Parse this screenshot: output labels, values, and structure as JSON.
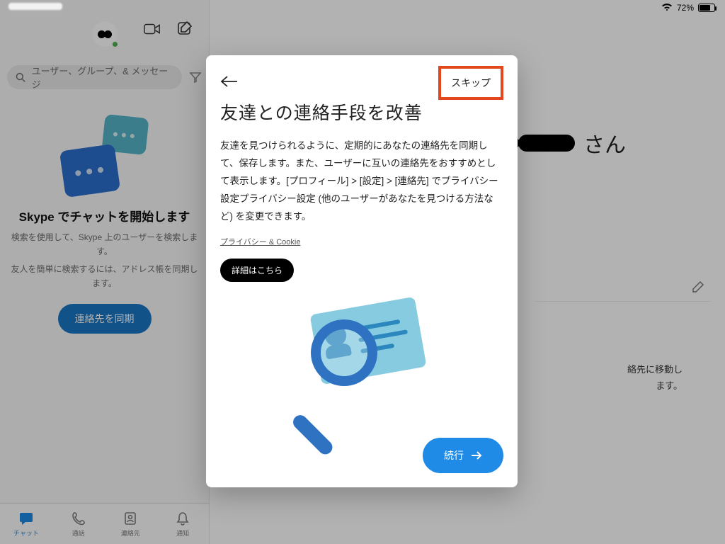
{
  "status": {
    "battery_pct": "72%"
  },
  "left": {
    "search_placeholder": "ユーザー、グループ、& メッセージ",
    "empty_title": "Skype でチャットを開始します",
    "empty_line1": "検索を使用して、Skype 上のユーザーを検索します。",
    "empty_line2": "友人を簡単に検索するには、アドレス帳を同期します。",
    "sync_label": "連絡先を同期",
    "tabs": {
      "chat": "チャット",
      "calls": "通話",
      "contacts": "連絡先",
      "notifications": "通知"
    }
  },
  "right": {
    "name_suffix": "さん",
    "snippet_line1": "絡先に移動し",
    "snippet_line2": "ます。"
  },
  "modal": {
    "skip_label": "スキップ",
    "title": "友達との連絡手段を改善",
    "body": "友達を見つけられるように、定期的にあなたの連絡先を同期して、保存します。また、ユーザーに互いの連絡先をおすすめとして表示します。[プロフィール] > [設定]  > [連絡先] でプライバシー設定プライバシー設定 (他のユーザーがあなたを見つける方法など) を変更できます。",
    "privacy_link": "プライバシー & Cookie",
    "detail_label": "詳細はこちら",
    "continue_label": "続行"
  }
}
